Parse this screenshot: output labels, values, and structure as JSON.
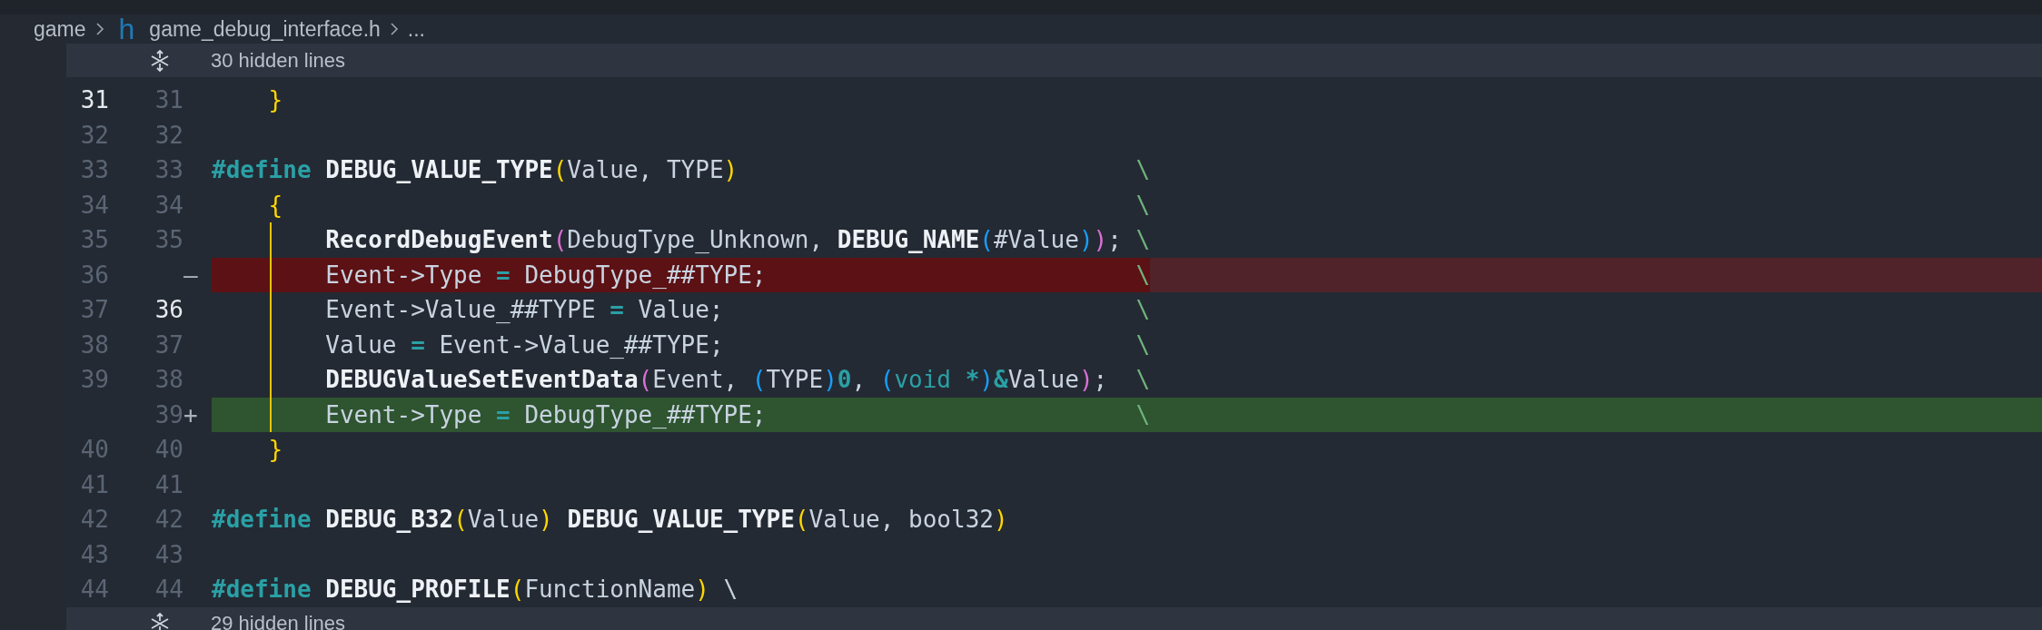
{
  "breadcrumb": {
    "folder": "game",
    "file_icon": "h",
    "file": "game_debug_interface.h",
    "more": "..."
  },
  "hidden_top": {
    "text": "30 hidden lines"
  },
  "lines": [
    {
      "old": "31",
      "new": "31",
      "old_active": true,
      "new_active": false,
      "kind": "normal",
      "guide": false,
      "tokens": [
        {
          "t": "    }",
          "kind": "p1"
        }
      ]
    },
    {
      "old": "32",
      "new": "32",
      "old_active": false,
      "new_active": false,
      "kind": "normal",
      "guide": false
    },
    {
      "old": "33",
      "new": "33",
      "old_active": false,
      "new_active": false,
      "kind": "normal",
      "guide": false,
      "tokens": [
        {
          "t": "#define ",
          "kind": "kw"
        },
        {
          "t": "DEBUG_VALUE_TYPE",
          "kind": "macro"
        },
        {
          "t": "(",
          "kind": "p1"
        },
        {
          "t": "Value, TYPE",
          "kind": "txt"
        },
        {
          "t": ")",
          "kind": "p1"
        }
      ],
      "tail": "\\"
    },
    {
      "old": "34",
      "new": "34",
      "old_active": false,
      "new_active": false,
      "kind": "normal",
      "guide": false,
      "tokens": [
        {
          "t": "    {",
          "kind": "p1"
        }
      ],
      "tail": "\\"
    },
    {
      "old": "35",
      "new": "35",
      "old_active": false,
      "new_active": false,
      "kind": "normal",
      "guide": true,
      "tokens": [
        {
          "t": "        RecordDebugEvent",
          "kind": "macro"
        },
        {
          "t": "(",
          "kind": "p2"
        },
        {
          "t": "DebugType_Unknown, ",
          "kind": "txt"
        },
        {
          "t": "DEBUG_NAME",
          "kind": "macro"
        },
        {
          "t": "(",
          "kind": "p3"
        },
        {
          "t": "#Value",
          "kind": "txt"
        },
        {
          "t": ")",
          "kind": "p3"
        },
        {
          "t": ")",
          "kind": "p2"
        },
        {
          "t": ";",
          "kind": "txt"
        }
      ],
      "tail": "\\"
    },
    {
      "old": "36",
      "marker": "—",
      "old_active": false,
      "kind": "removed",
      "guide": true,
      "tokens": [
        {
          "t": "        Event->Type ",
          "kind": "txt"
        },
        {
          "t": "=",
          "kind": "op"
        },
        {
          "t": " DebugType_##TYPE;",
          "kind": "txt"
        }
      ],
      "tail": "\\"
    },
    {
      "old": "37",
      "new": "36",
      "old_active": false,
      "new_active": true,
      "kind": "normal",
      "guide": true,
      "tokens": [
        {
          "t": "        Event->Value_##TYPE ",
          "kind": "txt"
        },
        {
          "t": "=",
          "kind": "op"
        },
        {
          "t": " Value;",
          "kind": "txt"
        }
      ],
      "tail": "\\"
    },
    {
      "old": "38",
      "new": "37",
      "old_active": false,
      "new_active": false,
      "kind": "normal",
      "guide": true,
      "tokens": [
        {
          "t": "        Value ",
          "kind": "txt"
        },
        {
          "t": "=",
          "kind": "op"
        },
        {
          "t": " Event->Value_##TYPE;",
          "kind": "txt"
        }
      ],
      "tail": "\\"
    },
    {
      "old": "39",
      "new": "38",
      "old_active": false,
      "new_active": false,
      "kind": "normal",
      "guide": true,
      "tokens": [
        {
          "t": "        DEBUGValueSetEventData",
          "kind": "macro"
        },
        {
          "t": "(",
          "kind": "p2"
        },
        {
          "t": "Event, ",
          "kind": "txt"
        },
        {
          "t": "(",
          "kind": "p3"
        },
        {
          "t": "TYPE",
          "kind": "txt"
        },
        {
          "t": ")",
          "kind": "p3"
        },
        {
          "t": "0",
          "kind": "num"
        },
        {
          "t": ", ",
          "kind": "txt"
        },
        {
          "t": "(",
          "kind": "p3"
        },
        {
          "t": "void ",
          "kind": "type"
        },
        {
          "t": "*",
          "kind": "op"
        },
        {
          "t": ")",
          "kind": "p3"
        },
        {
          "t": "&",
          "kind": "op"
        },
        {
          "t": "Value",
          "kind": "txt"
        },
        {
          "t": ")",
          "kind": "p2"
        },
        {
          "t": ";",
          "kind": "txt"
        }
      ],
      "tail": "\\"
    },
    {
      "new": "39",
      "marker": "+",
      "new_active": false,
      "kind": "added",
      "guide": true,
      "tokens": [
        {
          "t": "        Event->Type ",
          "kind": "txt"
        },
        {
          "t": "=",
          "kind": "op"
        },
        {
          "t": " DebugType_##TYPE;",
          "kind": "txt"
        }
      ],
      "tail": "\\"
    },
    {
      "old": "40",
      "new": "40",
      "old_active": false,
      "new_active": false,
      "kind": "normal",
      "guide": false,
      "tokens": [
        {
          "t": "    }",
          "kind": "p1"
        }
      ]
    },
    {
      "old": "41",
      "new": "41",
      "old_active": false,
      "new_active": false,
      "kind": "normal",
      "guide": false
    },
    {
      "old": "42",
      "new": "42",
      "old_active": false,
      "new_active": false,
      "kind": "normal",
      "guide": false,
      "tokens": [
        {
          "t": "#define ",
          "kind": "kw"
        },
        {
          "t": "DEBUG_B32",
          "kind": "macro"
        },
        {
          "t": "(",
          "kind": "p1"
        },
        {
          "t": "Value",
          "kind": "txt"
        },
        {
          "t": ") ",
          "kind": "p1"
        },
        {
          "t": "DEBUG_VALUE_TYPE",
          "kind": "macro"
        },
        {
          "t": "(",
          "kind": "p1"
        },
        {
          "t": "Value, bool32",
          "kind": "txt"
        },
        {
          "t": ")",
          "kind": "p1"
        }
      ]
    },
    {
      "old": "43",
      "new": "43",
      "old_active": false,
      "new_active": false,
      "kind": "normal",
      "guide": false
    },
    {
      "old": "44",
      "new": "44",
      "old_active": false,
      "new_active": false,
      "kind": "normal",
      "guide": false,
      "tokens": [
        {
          "t": "#define ",
          "kind": "kw"
        },
        {
          "t": "DEBUG_PROFILE",
          "kind": "macro"
        },
        {
          "t": "(",
          "kind": "p1"
        },
        {
          "t": "FunctionName",
          "kind": "txt"
        },
        {
          "t": ")",
          "kind": "p1"
        },
        {
          "t": " \\",
          "kind": "txt"
        }
      ]
    }
  ],
  "hidden_bottom": {
    "text": "29 hidden lines"
  }
}
